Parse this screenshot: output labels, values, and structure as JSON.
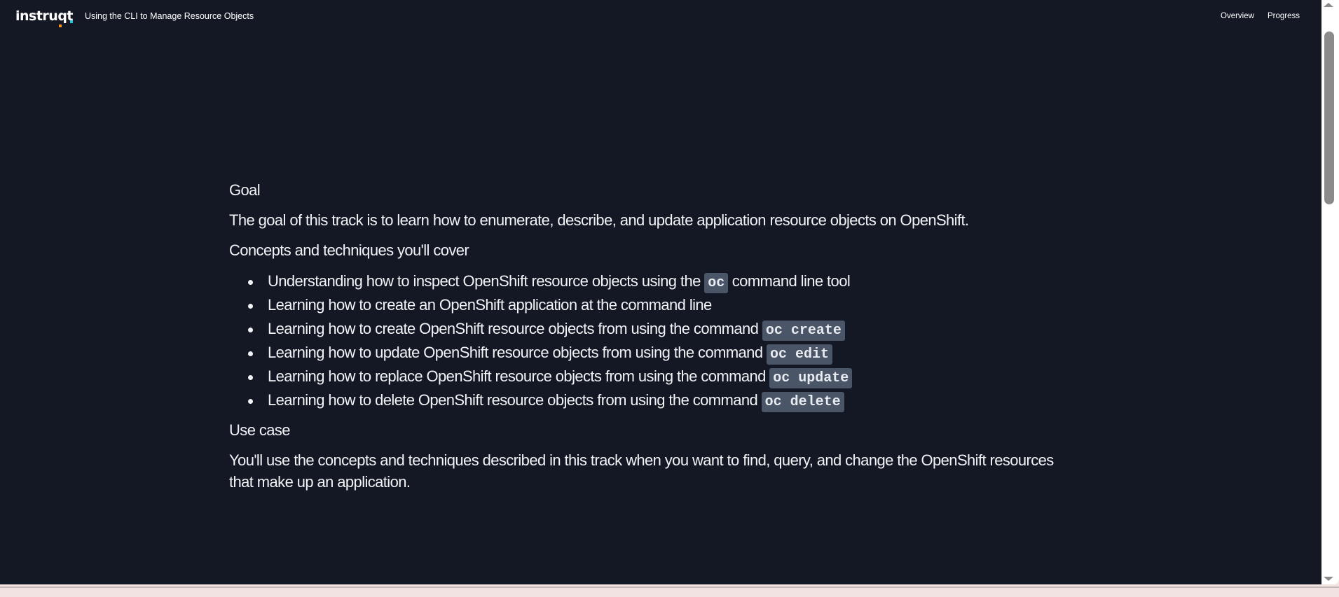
{
  "header": {
    "logo": "instruqt",
    "track_title": "Using the CLI to Manage Resource Objects",
    "nav": {
      "overview": "Overview",
      "progress": "Progress"
    }
  },
  "content": {
    "goal_heading": "Goal",
    "goal_text": "The goal of this track is to learn how to enumerate, describe, and update application resource objects on OpenShift.",
    "concepts_heading": "Concepts and techniques you'll cover",
    "items": [
      {
        "text": "Understanding how to inspect OpenShift resource objects using the ",
        "code": "oc",
        "after": " command line tool"
      },
      {
        "text": "Learning how to create an OpenShift application at the command line",
        "code": null,
        "after": ""
      },
      {
        "text": "Learning how to create OpenShift resource objects from using the command ",
        "code": "oc create",
        "after": ""
      },
      {
        "text": "Learning how to update OpenShift resource objects from using the command ",
        "code": "oc edit",
        "after": ""
      },
      {
        "text": "Learning how to replace OpenShift resource objects from using the command ",
        "code": "oc update",
        "after": ""
      },
      {
        "text": "Learning how to delete OpenShift resource objects from using the command ",
        "code": "oc delete",
        "after": ""
      }
    ],
    "usecase_heading": "Use case",
    "usecase_text": "You'll use the concepts and techniques described in this track when you want to find, query, and change the OpenShift resources that make up an application."
  },
  "colors": {
    "background": "#141824",
    "code_bg": "#4a5568",
    "text": "#f1f3f6"
  }
}
